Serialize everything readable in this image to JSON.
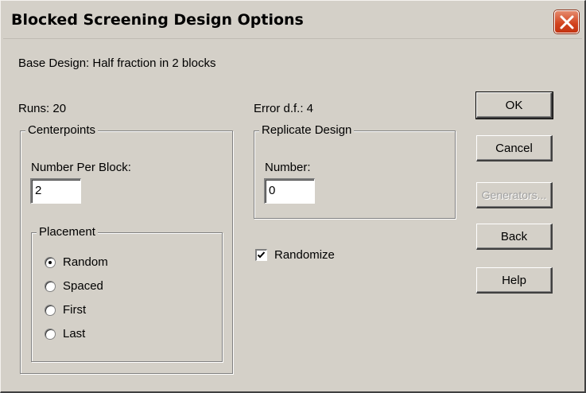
{
  "window": {
    "title": "Blocked Screening Design Options",
    "close_icon": "close-icon"
  },
  "base_design": "Base Design:  Half fraction in 2 blocks",
  "runs": "Runs: 20",
  "error_df": "Error d.f.:   4",
  "centerpoints": {
    "legend": "Centerpoints",
    "number_per_block_label": "Number Per Block:",
    "number_per_block_value": "2",
    "placement": {
      "legend": "Placement",
      "options": [
        "Random",
        "Spaced",
        "First",
        "Last"
      ],
      "selected": "Random"
    }
  },
  "replicate_design": {
    "legend": "Replicate Design",
    "number_label": "Number:",
    "number_value": "0"
  },
  "randomize": {
    "label": "Randomize",
    "checked": true
  },
  "buttons": {
    "ok": "OK",
    "cancel": "Cancel",
    "generators": "Generators...",
    "back": "Back",
    "help": "Help"
  },
  "colors": {
    "face": "#d4d0c8",
    "close_button": "#d2421d",
    "disabled_text": "#a0a0a0"
  }
}
